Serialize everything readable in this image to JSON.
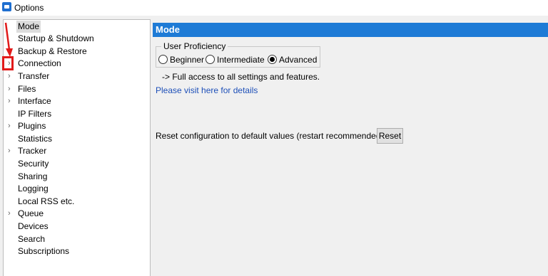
{
  "window": {
    "title": "Options"
  },
  "tree": {
    "items": [
      {
        "label": "Mode",
        "expandable": false,
        "selected": true
      },
      {
        "label": "Startup & Shutdown",
        "expandable": false
      },
      {
        "label": "Backup & Restore",
        "expandable": false
      },
      {
        "label": "Connection",
        "expandable": true
      },
      {
        "label": "Transfer",
        "expandable": true
      },
      {
        "label": "Files",
        "expandable": true
      },
      {
        "label": "Interface",
        "expandable": true
      },
      {
        "label": "IP Filters",
        "expandable": false
      },
      {
        "label": "Plugins",
        "expandable": true
      },
      {
        "label": "Statistics",
        "expandable": false
      },
      {
        "label": "Tracker",
        "expandable": true
      },
      {
        "label": "Security",
        "expandable": false
      },
      {
        "label": "Sharing",
        "expandable": false
      },
      {
        "label": "Logging",
        "expandable": false
      },
      {
        "label": "Local RSS etc.",
        "expandable": false
      },
      {
        "label": "Queue",
        "expandable": true
      },
      {
        "label": "Devices",
        "expandable": false
      },
      {
        "label": "Search",
        "expandable": false
      },
      {
        "label": "Subscriptions",
        "expandable": false
      }
    ],
    "expander_glyph": "›"
  },
  "panel": {
    "header": "Mode",
    "proficiency": {
      "legend": "User Proficiency",
      "options": [
        "Beginner",
        "Intermediate",
        "Advanced"
      ],
      "selected": "Advanced"
    },
    "access_text": "-> Full access to all settings and features.",
    "details_link": "Please visit here for details",
    "reset_text": "Reset configuration to default values (restart recommended)",
    "reset_button": "Reset"
  },
  "colors": {
    "header_bg": "#1e7bd6",
    "annotation": "#e11a1a",
    "link": "#1d4fb8"
  }
}
